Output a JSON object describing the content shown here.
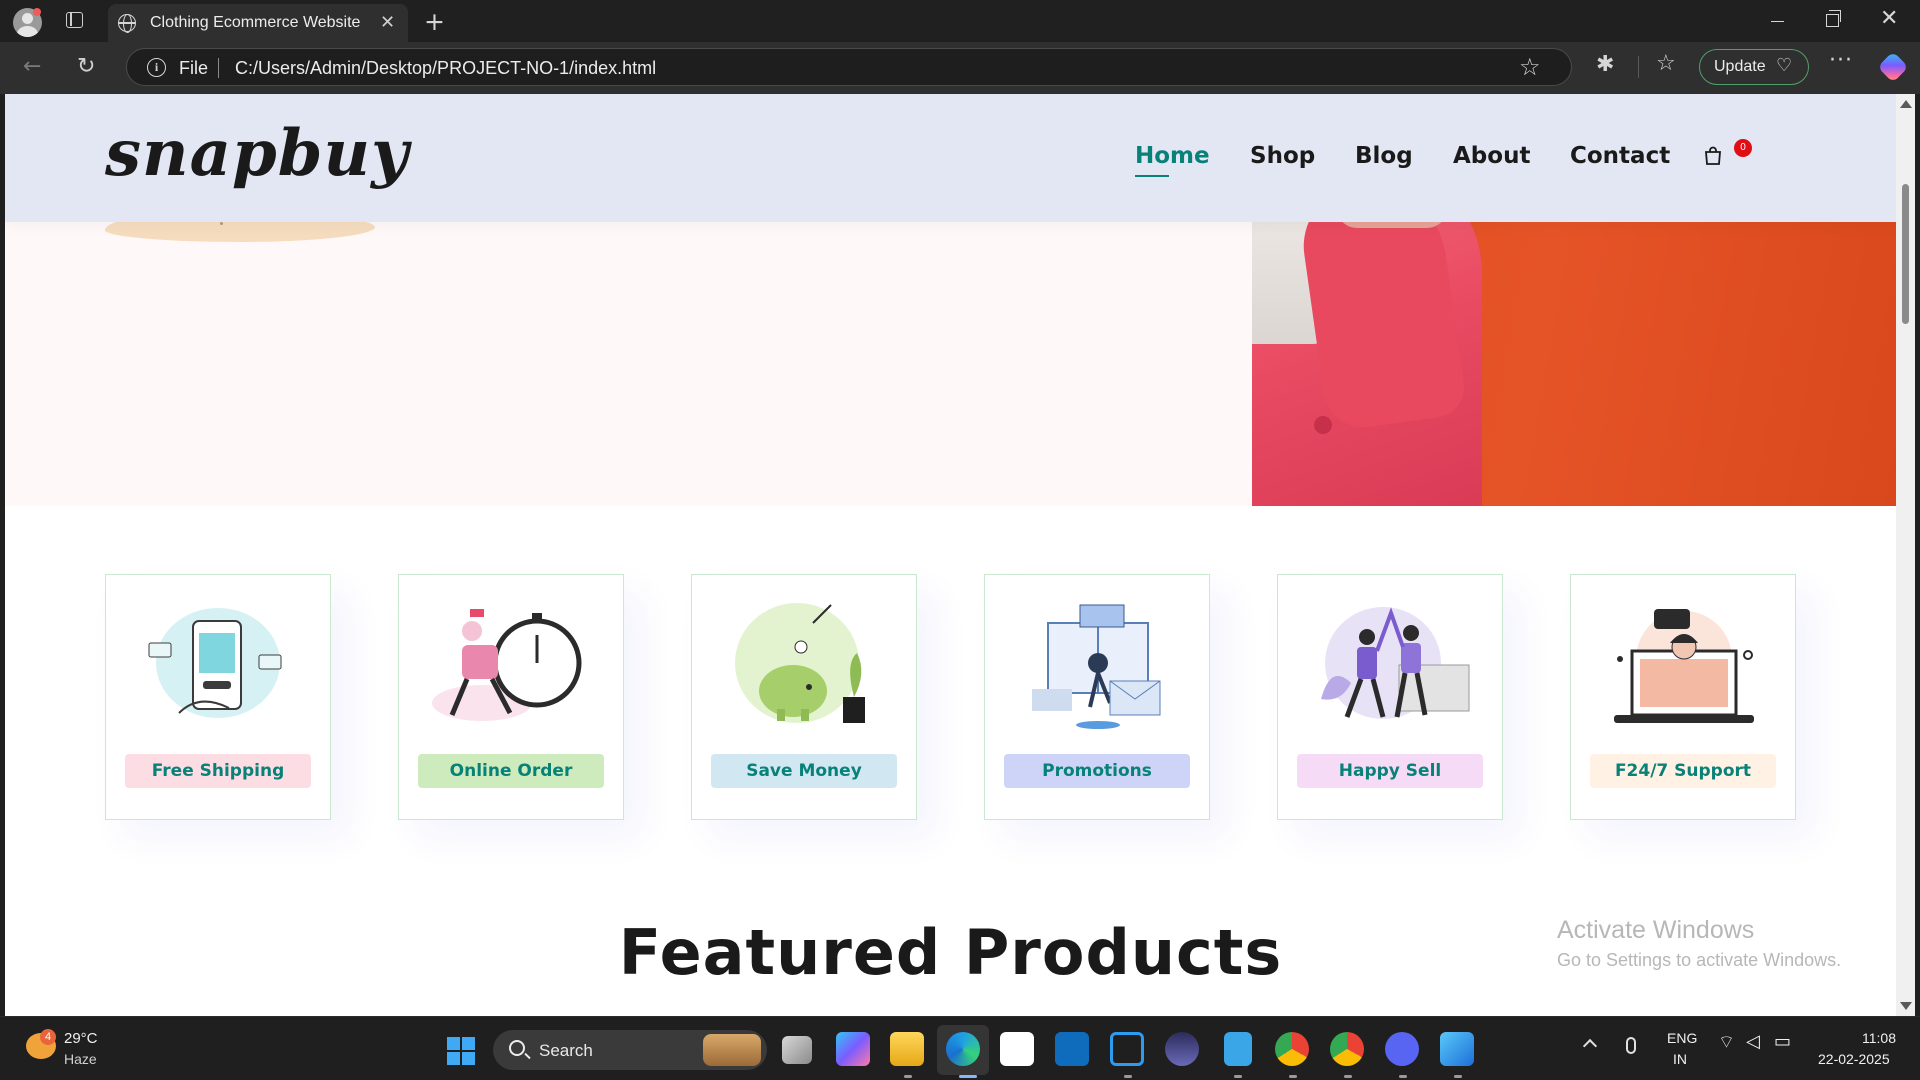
{
  "browser": {
    "tab_title": "Clothing Ecommerce Website",
    "file_label": "File",
    "url": "C:/Users/Admin/Desktop/PROJECT-NO-1/index.html",
    "update_label": "Update"
  },
  "site": {
    "logo": "snapbuy",
    "nav": {
      "home": "Home",
      "shop": "Shop",
      "blog": "Blog",
      "about": "About",
      "contact": "Contact"
    },
    "cart_count": "0",
    "accent_color": "#088178",
    "features": [
      {
        "label": "Free Shipping",
        "bg": "#fddde4",
        "icon": "payment-phone-illustration"
      },
      {
        "label": "Online Order",
        "bg": "#cdebbc",
        "icon": "delivery-clock-illustration"
      },
      {
        "label": "Save Money",
        "bg": "#d1e8f2",
        "icon": "piggy-bank-illustration"
      },
      {
        "label": "Promotions",
        "bg": "#cdd4f8",
        "icon": "gift-envelope-illustration"
      },
      {
        "label": "Happy Sell",
        "bg": "#f6dbf6",
        "icon": "high-five-illustration"
      },
      {
        "label": "F24/7 Support",
        "bg": "#fff2e5",
        "icon": "support-laptop-illustration"
      }
    ],
    "featured_title": "Featured Products"
  },
  "watermark": {
    "title": "Activate Windows",
    "subtitle": "Go to Settings to activate Windows."
  },
  "taskbar": {
    "temperature": "29°C",
    "weather": "Haze",
    "weather_badge": "4",
    "search_label": "Search",
    "lang1": "ENG",
    "lang2": "IN",
    "time": "11:08",
    "date": "22-02-2025"
  }
}
